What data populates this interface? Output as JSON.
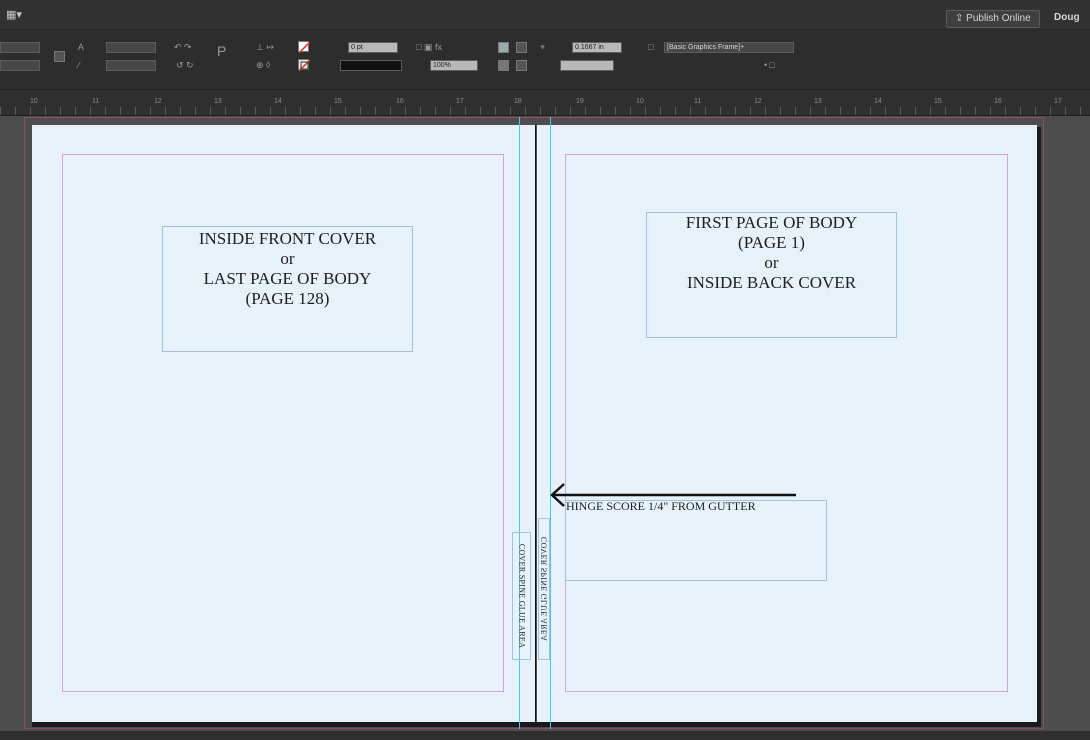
{
  "topbar": {
    "menu_glyph": "▦▾",
    "publish_label": "⇪ Publish Online",
    "user_name": "Doug"
  },
  "control": {
    "stroke_weight": "0 pt",
    "zoom_percent": "100%",
    "fitting_value": "0.1667 in",
    "object_style": "[Basic Graphics Frame]+"
  },
  "ruler": {
    "numbers": [
      "10",
      "11",
      "12",
      "13",
      "14",
      "15",
      "16",
      "17",
      "18",
      "19",
      "10",
      "11",
      "12",
      "13",
      "14",
      "15",
      "16",
      "17"
    ]
  },
  "spread": {
    "left_frame": {
      "lines": [
        "INSIDE FRONT COVER",
        "or",
        "LAST PAGE OF BODY",
        "(PAGE 128)"
      ]
    },
    "right_frame": {
      "lines": [
        "FIRST PAGE OF BODY",
        "(PAGE 1)",
        "or",
        "INSIDE BACK COVER"
      ]
    },
    "spine_left_label": "COVER SPINE GLUE AREA",
    "spine_right_label": "COVER SPINE GLUE AREA",
    "hinge_label": "HINGE SCORE 1/4\" FROM GUTTER"
  },
  "colors": {
    "page": "#e6f1fa",
    "margin_guide": "#d7a2de",
    "column_guide": "#44c9e8",
    "frame_edge": "#9dc2e4",
    "bleed": "#8c4a5a"
  }
}
